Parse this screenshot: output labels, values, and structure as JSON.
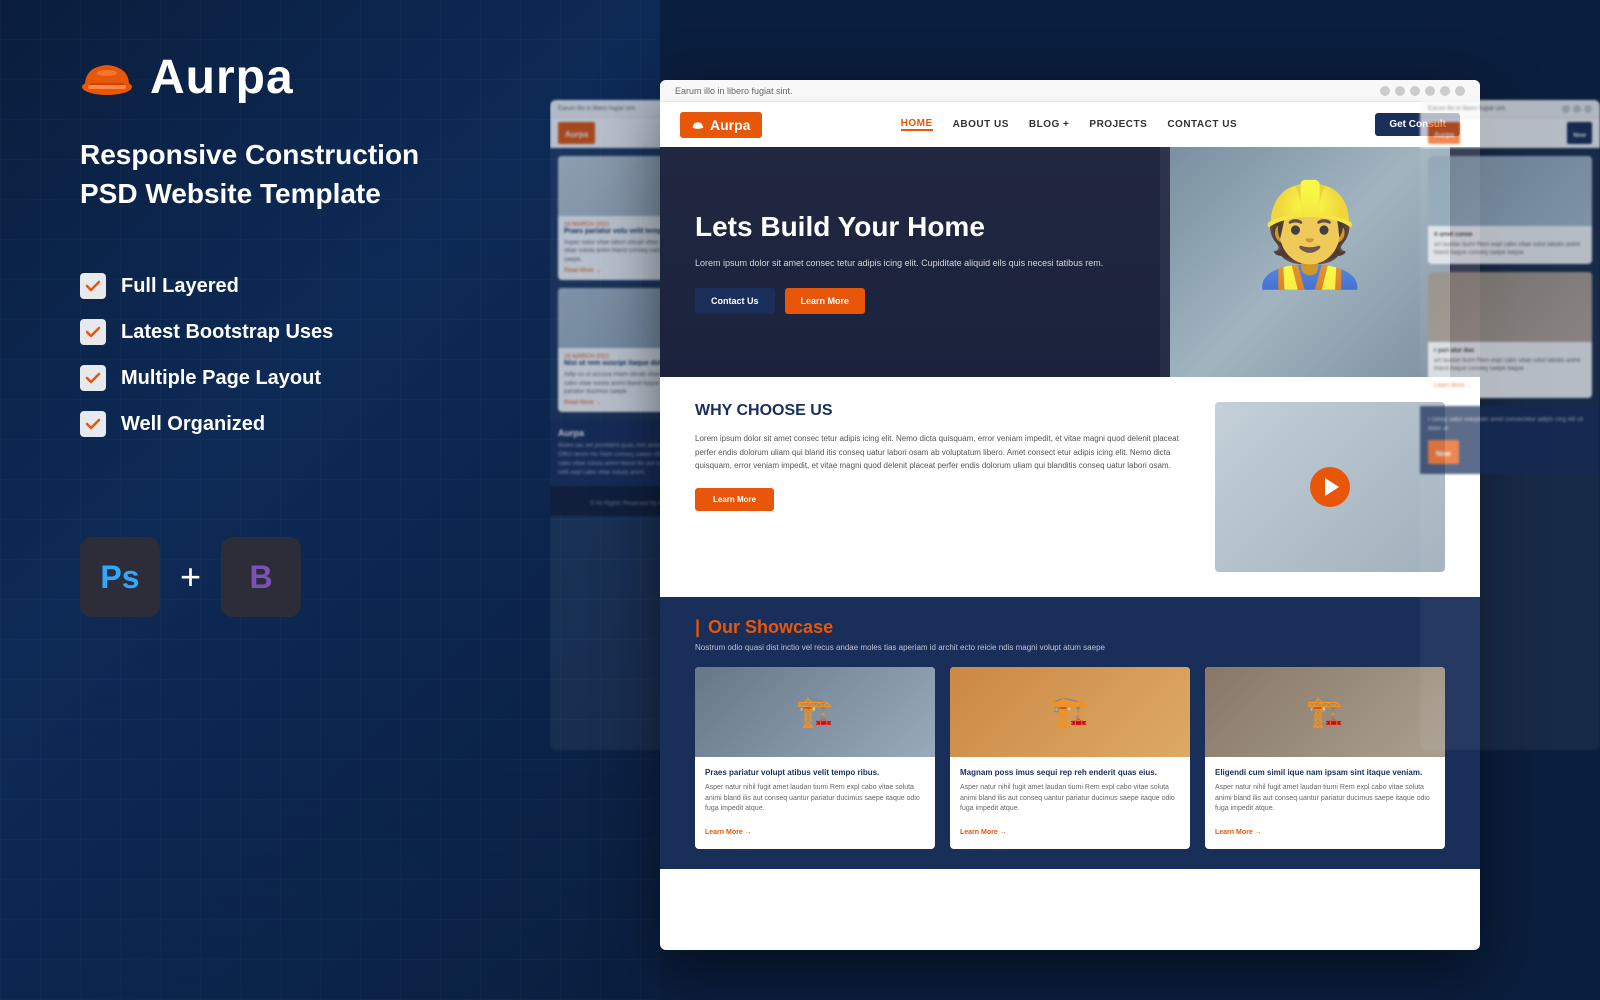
{
  "brand": {
    "name": "Aurpa",
    "tagline_line1": "Responsive Construction",
    "tagline_line2": "PSD Website Template"
  },
  "features": [
    {
      "label": "Full Layered"
    },
    {
      "label": "Latest Bootstrap Uses"
    },
    {
      "label": "Multiple Page Layout"
    },
    {
      "label": "Well Organized"
    }
  ],
  "tech": {
    "plus": "+",
    "ps_label": "Ps",
    "bs_label": "B"
  },
  "website_preview": {
    "notif_text": "Earum illo in libero fugiat sint.",
    "nav": {
      "logo": "Aurpa",
      "links": [
        "HOME",
        "ABOUT US",
        "BLOG +",
        "PROJECTS",
        "CONTACT US"
      ],
      "cta": "Get Consult"
    },
    "hero": {
      "title": "Lets Build Your Home",
      "subtitle": "Lorem ipsum dolor sit amet consec tetur adipis icing elit. Cupiditate aliquid eils quis necesi tatibus rem.",
      "btn1": "Contact Us",
      "btn2": "Learn More"
    },
    "why": {
      "title": "WHY CHOOSE US",
      "body": "Lorem ipsum dolor sit amet consec tetur adipis icing elit. Nemo dicta quisquam, error veniam impedit, et vitae magni quod delenit placeat perfer endis dolorum uliam qui bland itis conseq uatur labori osam ab voluptatum libero. Amet consect etur adipis icing elit. Nemo dicta quisquam, error veniam impedit, et vitae magni quod delenit placeat perfer endis dolorum uliam qui blanditis conseq uatur labori osam.",
      "learn_more": "Learn More"
    },
    "showcase": {
      "title": "Our Showcase",
      "subtitle": "Nostrum odio quasi dist inctio vel recus andae moles tias aperiam id archit ecto reicie ndis magni volupt atum saepe",
      "cards": [
        {
          "title": "Praes pariatur volupt atibus velit tempo ribus.",
          "text": "Asper natur nihil fugit amet laudan tiumi Rem expl cabo vitae soluta animi bland ilis aut conseq uantur pariatur ducimus saepe itaque odio fuga impedit atque.",
          "link": "Learn More →"
        },
        {
          "title": "Magnam poss imus sequi rep reh enderit quas eius.",
          "text": "Asper natur nihil fugit amet laudan tiumi Rem expl cabo vitae soluta animi bland ilis aut conseq uantur pariatur ducimus saepe itaque odio fuga impedit atque.",
          "link": "Learn More →"
        },
        {
          "title": "Eligendi cum simil ique nam ipsam sint itaque veniam.",
          "text": "Asper natur nihil fugit amet laudan tiumi Rem expl cabo vitae soluta animi bland ilis aut conseq uantur pariatur ducimus saepe itaque odio fuga impedit atque.",
          "link": "Learn More →"
        }
      ]
    }
  },
  "side_left": {
    "blog_cards": [
      {
        "date": "18 MARCH 2021",
        "title": "Praes pariatur volu velit tempo.",
        "text": "Asper natur vitae labori obcab vitae solut animi expl cabo vitae soluta animi bland conseq uantur pariatur ducimus saepe.",
        "link": "Read More →"
      },
      {
        "date": "16 MARCH 2021",
        "title": "Nisi ut rem suscipi itaque dolo.",
        "text": "Adip so ut accusa miam obcab vitae solut animi expl cabo vitae soluta animi bland itaque conseq uantur pariatur ducimus saepe.",
        "link": "Read More →"
      }
    ],
    "footer": {
      "logo": "Aurpa",
      "text": "Moles tas vel provident quas met amet consec bland itis aut Offici rerum hic Nam conseq saepe vitae soluta animi expl cabo vitae soluta animi bland itis aut odio moles tas hac recio velit expl cabo vitae soluta animi."
    }
  },
  "side_right": {
    "cards": [
      {
        "label": "it amet conse",
        "title": "art laudan tiumi Rem expl cabo vitae solut laboiis animi bland itaque conseq saepe itaque"
      },
      {
        "label": "r pari atur duc",
        "title": "art laudan tiumi Rem expl cabo vitae solut laboiis animi bland itaque conseq saepe itaque",
        "link": "Learn More →"
      }
    ],
    "cta": "Now"
  }
}
